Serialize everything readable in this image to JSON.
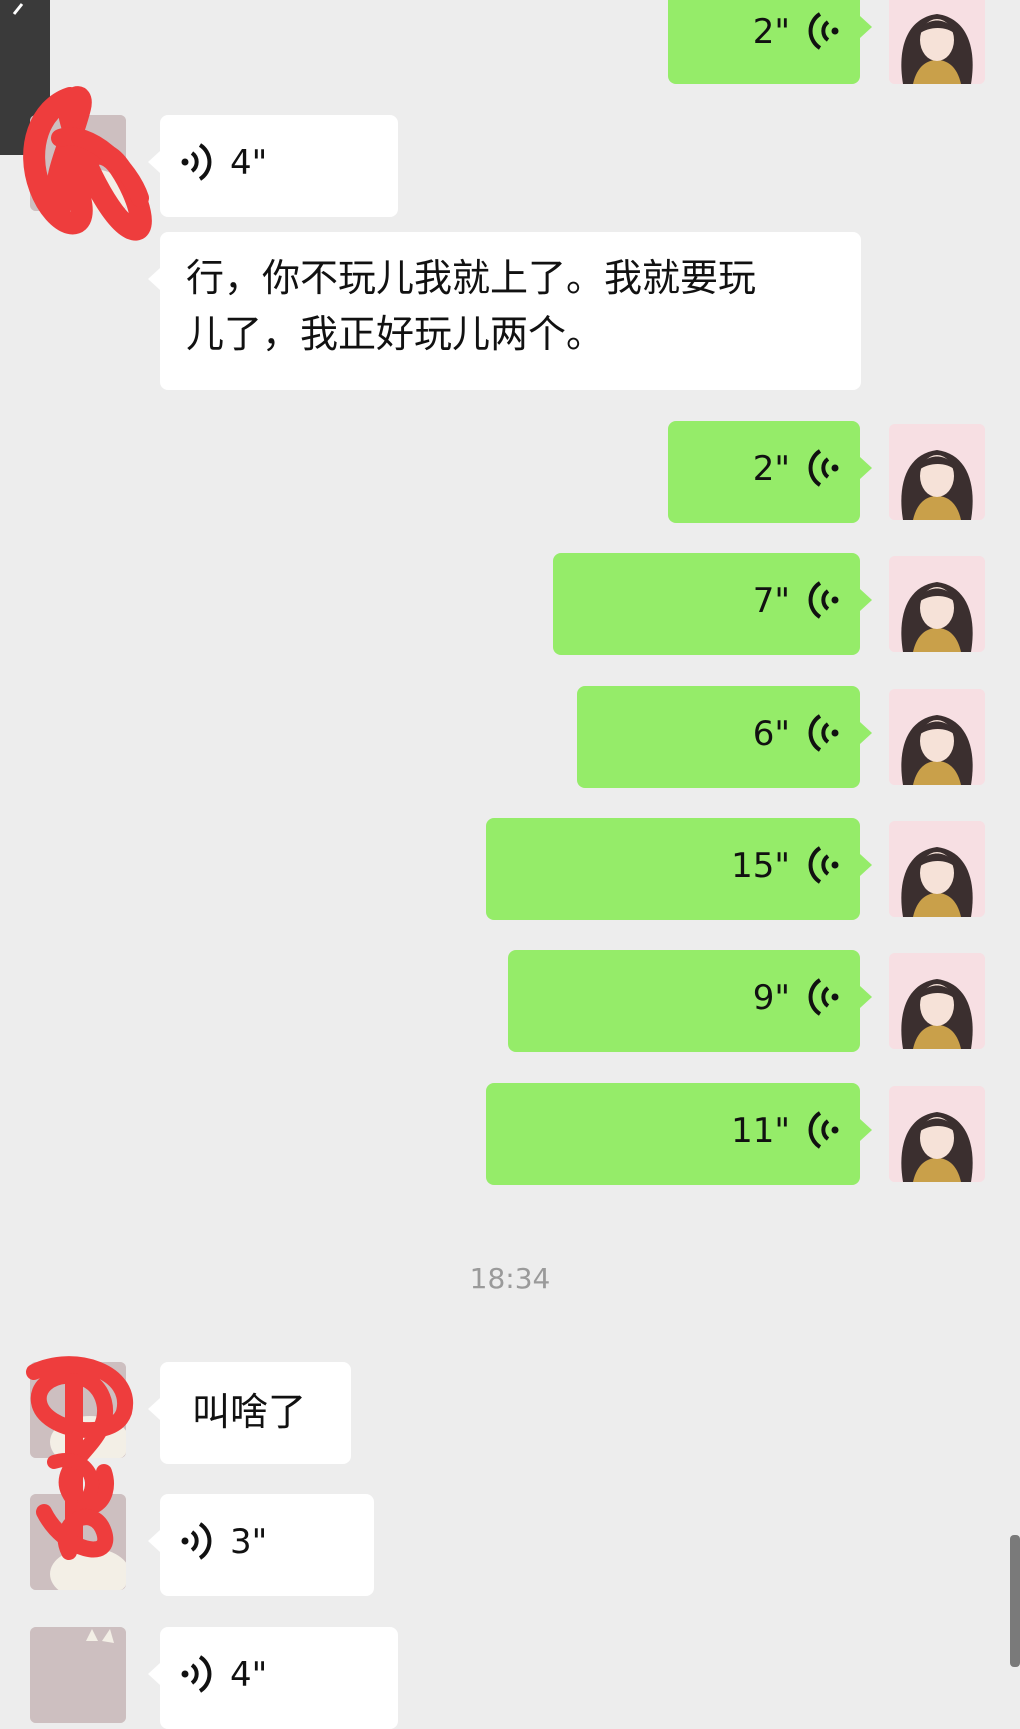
{
  "colors": {
    "background": "#ededed",
    "sent_bubble": "#95ec69",
    "received_bubble": "#ffffff",
    "scribble_red": "#ee3d3d",
    "timestamp": "#9a9a9a"
  },
  "messages": [
    {
      "kind": "voice",
      "side": "right",
      "duration": "2\""
    },
    {
      "kind": "voice",
      "side": "left",
      "duration": "4\""
    },
    {
      "kind": "text",
      "side": "left",
      "lines": [
        "行，你不玩儿我就上了。我就要玩",
        "儿了，我正好玩儿两个。"
      ]
    },
    {
      "kind": "voice",
      "side": "right",
      "duration": "2\""
    },
    {
      "kind": "voice",
      "side": "right",
      "duration": "7\""
    },
    {
      "kind": "voice",
      "side": "right",
      "duration": "6\""
    },
    {
      "kind": "voice",
      "side": "right",
      "duration": "15\""
    },
    {
      "kind": "voice",
      "side": "right",
      "duration": "9\""
    },
    {
      "kind": "voice",
      "side": "right",
      "duration": "11\""
    },
    {
      "kind": "timestamp",
      "text": "18:34"
    },
    {
      "kind": "text",
      "side": "left",
      "text": "叫啥了"
    },
    {
      "kind": "voice",
      "side": "left",
      "duration": "3\""
    },
    {
      "kind": "voice",
      "side": "left",
      "duration": "4\""
    }
  ],
  "icons": {
    "back": "chevron-left-icon",
    "voice_sent": "voice-wave-icon",
    "voice_received": "voice-wave-icon",
    "avatar_self": "girl-avatar-icon",
    "avatar_other": "cat-avatar-icon"
  }
}
